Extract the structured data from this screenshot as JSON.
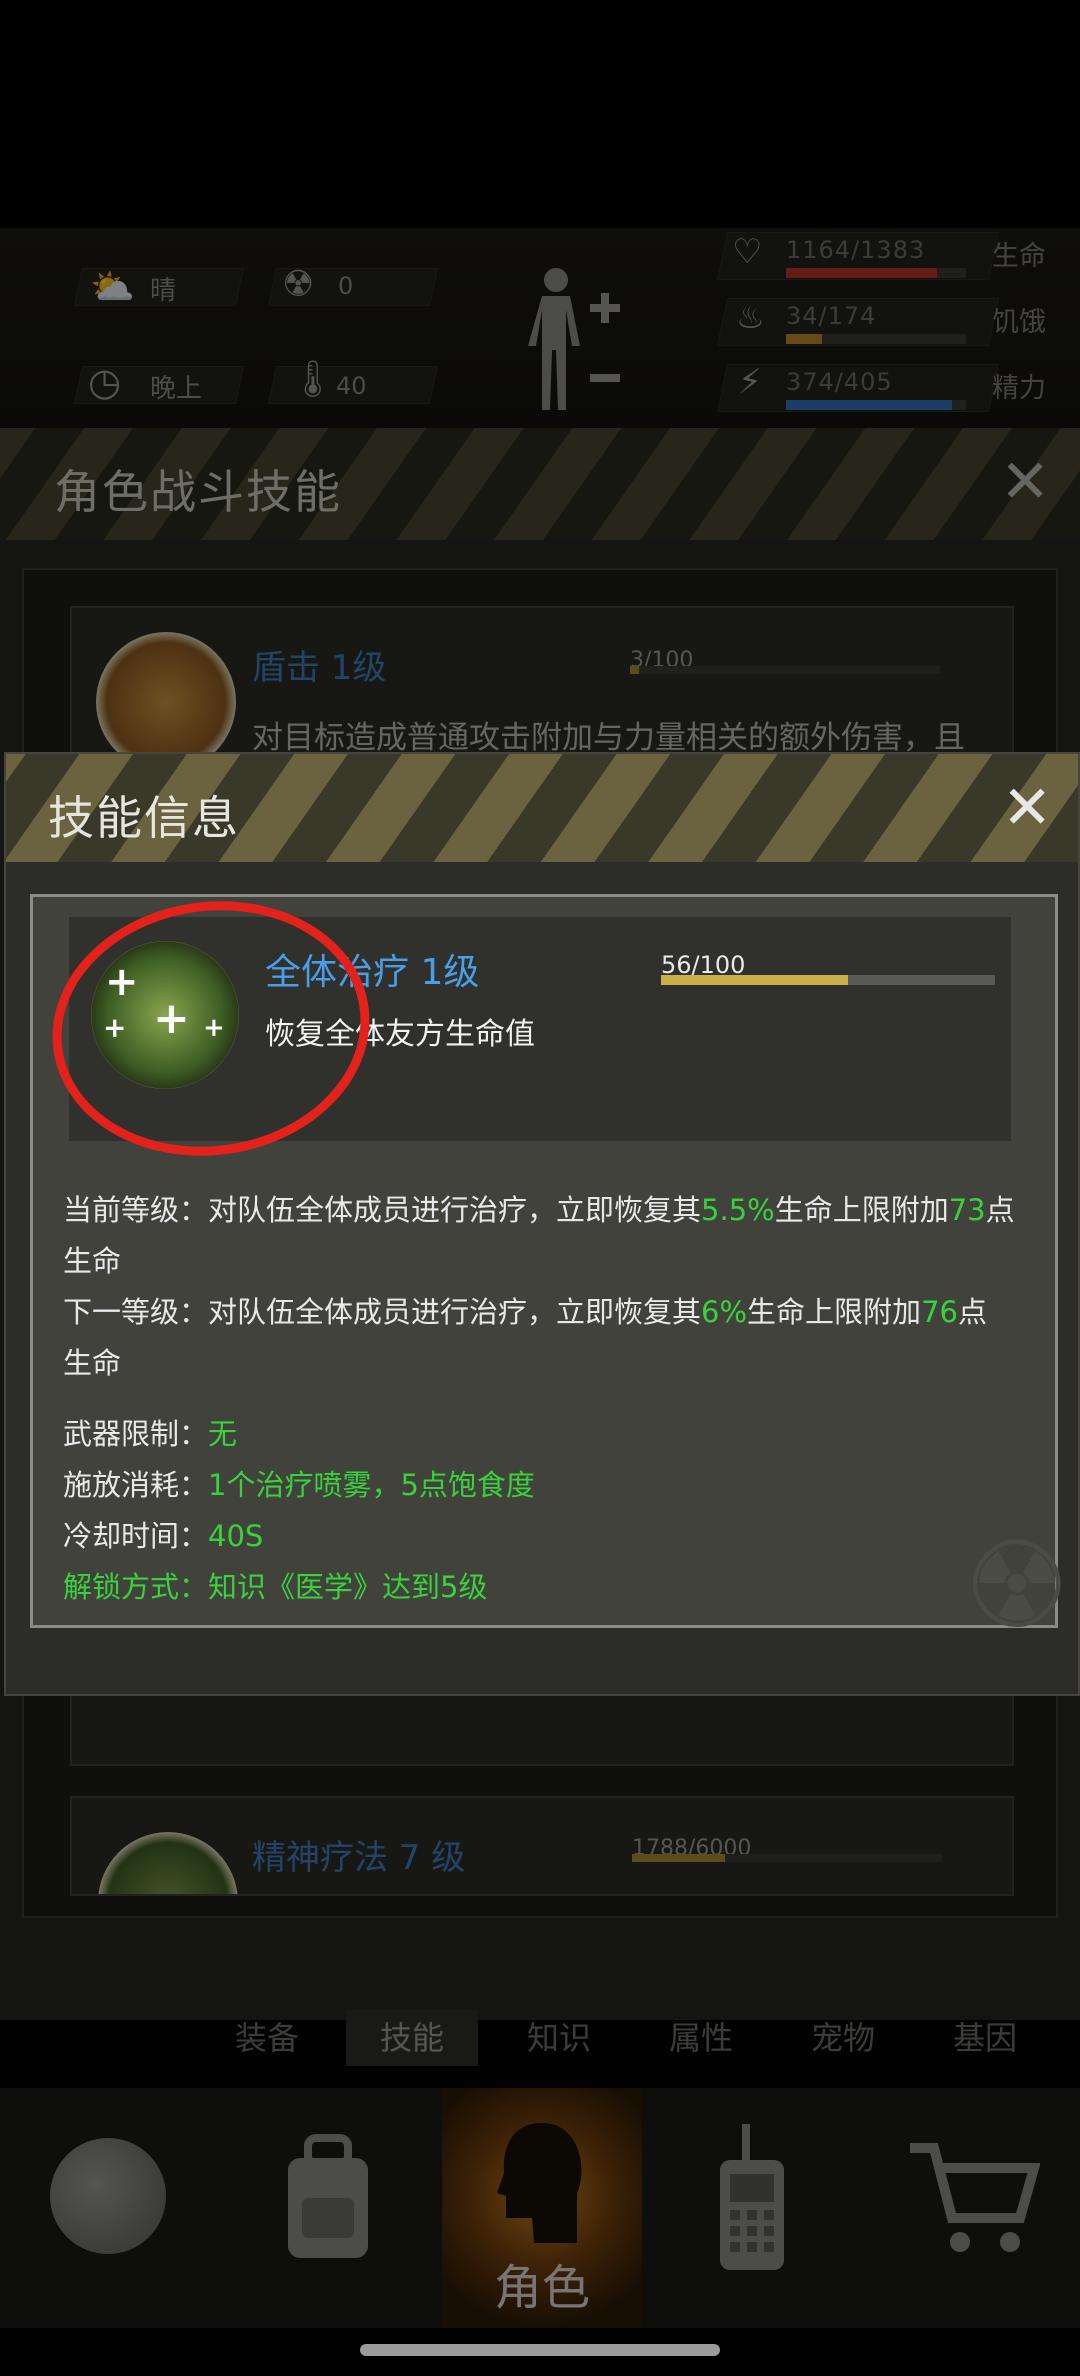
{
  "status": {
    "weather": "晴",
    "radiation": "0",
    "time": "晚上",
    "temperature": "40",
    "hp": {
      "value": "1164/1383",
      "label": "生命",
      "fraction": 0.84,
      "color": "#b8342a"
    },
    "hunger": {
      "value": "34/174",
      "label": "饥饿",
      "fraction": 0.2,
      "color": "#b88a2a"
    },
    "energy": {
      "value": "374/405",
      "label": "精力",
      "fraction": 0.92,
      "color": "#2f6fb8"
    }
  },
  "skills_panel": {
    "title": "角色战斗技能",
    "skill1": {
      "name": "盾击 1级",
      "progress": "3/100",
      "fraction": 0.03,
      "desc": "对目标造成普通攻击附加与力量相关的额外伤害，且"
    },
    "skill2": {
      "name": "精神疗法 7 级",
      "progress": "1788/6000",
      "fraction": 0.3
    }
  },
  "dialog": {
    "title": "技能信息",
    "skill_name": "全体治疗 1级",
    "progress": "56/100",
    "progress_fraction": 0.56,
    "short_desc": "恢复全体友方生命值",
    "current": {
      "label": "当前等级：",
      "text_a": "对队伍全体成员进行治疗，立即恢复其",
      "pct": "5.5%",
      "text_b": "生命上限附加",
      "num": "73",
      "text_c": "点",
      "text_d": "生命"
    },
    "next": {
      "label": "下一等级：",
      "text_a": "对队伍全体成员进行治疗，立即恢复其",
      "pct": "6%",
      "text_b": "生命上限附加",
      "num": "76",
      "text_c": "点",
      "text_d": "生命"
    },
    "weapon": {
      "label": "武器限制：",
      "value": "无"
    },
    "cost": {
      "label": "施放消耗：",
      "value": "1个治疗喷雾，5点饱食度"
    },
    "cooldown": {
      "label": "冷却时间：",
      "value": "40S"
    },
    "unlock": {
      "label": "解锁方式：",
      "value": "知识《医学》达到5级"
    }
  },
  "sub_tabs": [
    "装备",
    "技能",
    "知识",
    "属性",
    "宠物",
    "基因"
  ],
  "nav": {
    "active_label": "角色"
  }
}
